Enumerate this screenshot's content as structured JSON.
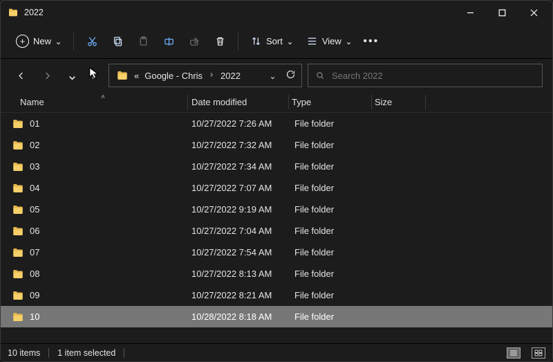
{
  "window": {
    "title": "2022"
  },
  "toolbar": {
    "new_label": "New",
    "sort_label": "Sort",
    "view_label": "View"
  },
  "breadcrumb": {
    "ellipsis": "«",
    "part1": "Google - Chris",
    "part2": "2022"
  },
  "search": {
    "placeholder": "Search 2022"
  },
  "columns": {
    "name": "Name",
    "date": "Date modified",
    "type": "Type",
    "size": "Size"
  },
  "rows": [
    {
      "name": "01",
      "date": "10/27/2022 7:26 AM",
      "type": "File folder",
      "size": "",
      "selected": false
    },
    {
      "name": "02",
      "date": "10/27/2022 7:32 AM",
      "type": "File folder",
      "size": "",
      "selected": false
    },
    {
      "name": "03",
      "date": "10/27/2022 7:34 AM",
      "type": "File folder",
      "size": "",
      "selected": false
    },
    {
      "name": "04",
      "date": "10/27/2022 7:07 AM",
      "type": "File folder",
      "size": "",
      "selected": false
    },
    {
      "name": "05",
      "date": "10/27/2022 9:19 AM",
      "type": "File folder",
      "size": "",
      "selected": false
    },
    {
      "name": "06",
      "date": "10/27/2022 7:04 AM",
      "type": "File folder",
      "size": "",
      "selected": false
    },
    {
      "name": "07",
      "date": "10/27/2022 7:54 AM",
      "type": "File folder",
      "size": "",
      "selected": false
    },
    {
      "name": "08",
      "date": "10/27/2022 8:13 AM",
      "type": "File folder",
      "size": "",
      "selected": false
    },
    {
      "name": "09",
      "date": "10/27/2022 8:21 AM",
      "type": "File folder",
      "size": "",
      "selected": false
    },
    {
      "name": "10",
      "date": "10/28/2022 8:18 AM",
      "type": "File folder",
      "size": "",
      "selected": true
    }
  ],
  "status": {
    "count": "10 items",
    "selected": "1 item selected"
  }
}
